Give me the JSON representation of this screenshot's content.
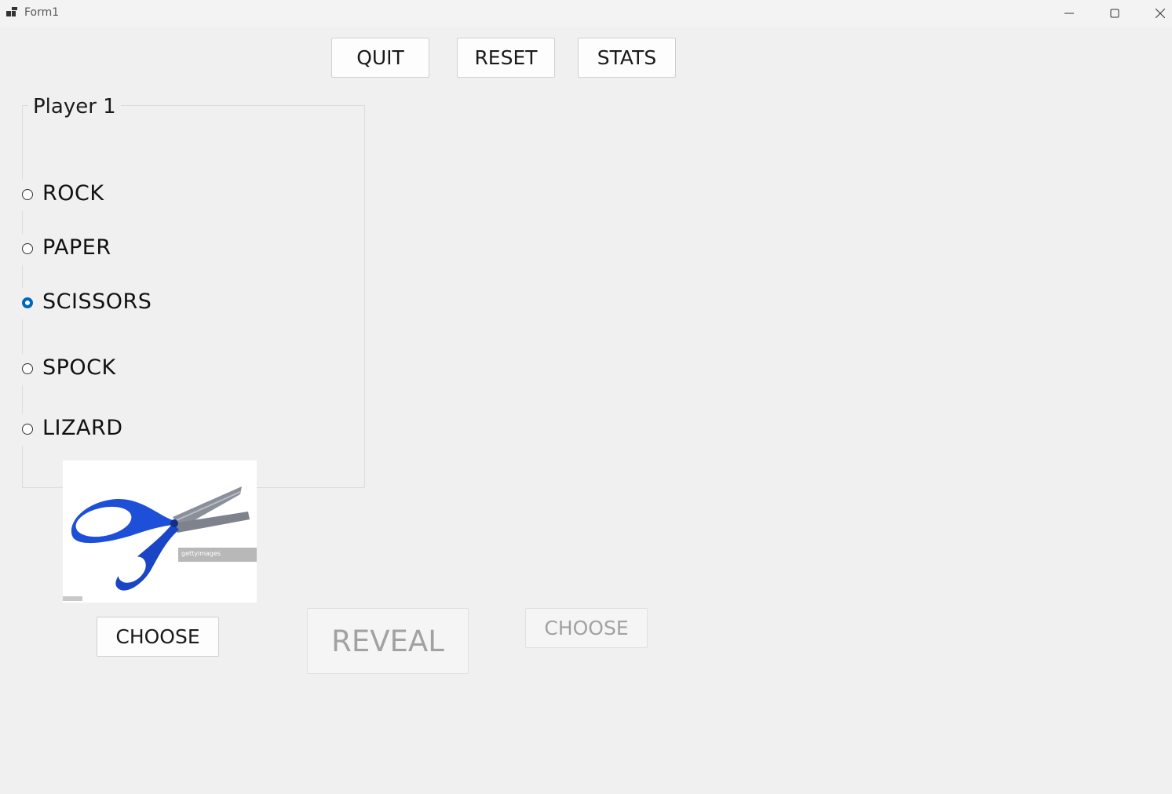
{
  "window": {
    "title": "Form1"
  },
  "toolbar": {
    "quit_label": "QUIT",
    "reset_label": "RESET",
    "stats_label": "STATS"
  },
  "player1": {
    "group_title": "Player 1",
    "options": [
      {
        "label": "ROCK",
        "checked": false
      },
      {
        "label": "PAPER",
        "checked": false
      },
      {
        "label": "SCISSORS",
        "checked": true
      },
      {
        "label": "SPOCK",
        "checked": false
      },
      {
        "label": "LIZARD",
        "checked": false
      }
    ],
    "choose_label": "CHOOSE",
    "image": {
      "icon": "scissors-image",
      "watermark": "gettyimages"
    }
  },
  "reveal": {
    "label": "REVEAL",
    "enabled": false
  },
  "player2": {
    "choose_label": "CHOOSE",
    "enabled": false
  },
  "colors": {
    "accent": "#0067c0",
    "scissors_blue": "#1d4fd8",
    "background": "#f0f0f0"
  }
}
